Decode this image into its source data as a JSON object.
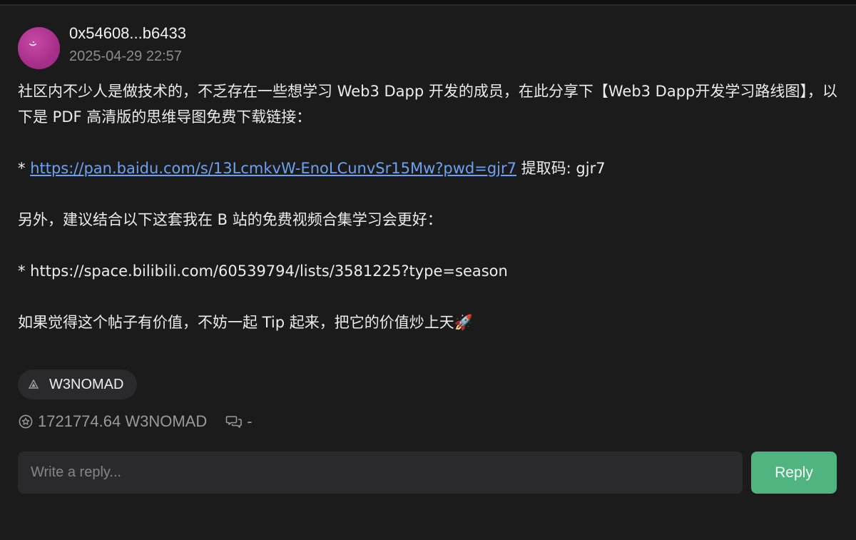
{
  "post": {
    "author": "0x54608...b6433",
    "timestamp": "2025-04-29 22:57",
    "content": {
      "line1": "社区内不少人是做技术的，不乏存在一些想学习 Web3 Dapp 开发的成员，在此分享下【Web3 Dapp开发学习路线图】，以下是 PDF 高清版的思维导图免费下载链接：",
      "bullet1_prefix": "* ",
      "bullet1_link": "https://pan.baidu.com/s/13LcmkvW-EnoLCunvSr15Mw?pwd=gjr7",
      "bullet1_suffix": " 提取码: gjr7",
      "line2": "另外，建议结合以下这套我在 B 站的免费视频合集学习会更好：",
      "bullet2": "* https://space.bilibili.com/60539794/lists/3581225?type=season",
      "line3": "如果觉得这个帖子有价值，不妨一起 Tip 起来，把它的价值炒上天🚀"
    },
    "tag": "W3NOMAD",
    "tip_amount": "1721774.64 W3NOMAD",
    "comment_count": "-"
  },
  "reply": {
    "placeholder": "Write a reply...",
    "value": "",
    "button_label": "Reply"
  },
  "icons": {
    "avatar": "avatar-smile-icon",
    "tag": "community-logo-icon",
    "tip": "tip-coin-icon",
    "comments": "comment-bubbles-icon"
  },
  "colors": {
    "background": "#1b1b1c",
    "link": "#6ea2f0",
    "reply_button": "#4fb47f",
    "muted_text": "#8c8c8e"
  }
}
